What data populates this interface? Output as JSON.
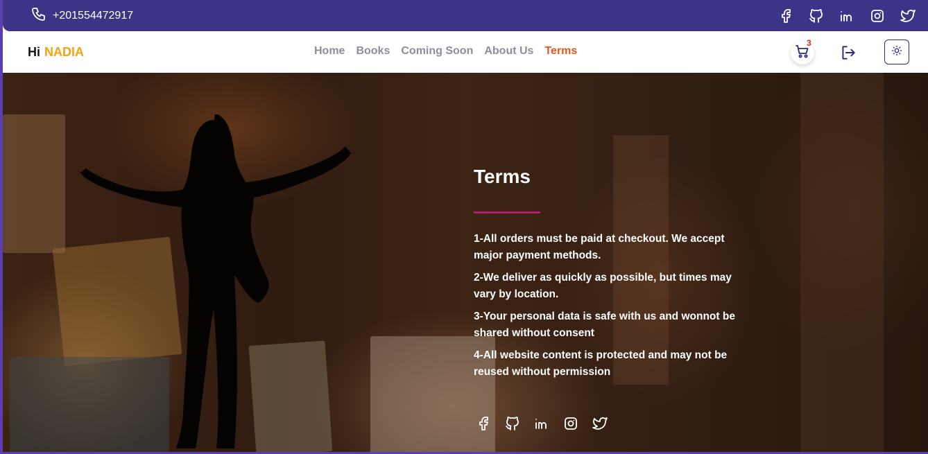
{
  "topbar": {
    "phone": "+201554472917",
    "socials": [
      "facebook-icon",
      "github-icon",
      "linkedin-icon",
      "instagram-icon",
      "twitter-icon"
    ]
  },
  "navbar": {
    "greeting": "Hi",
    "user_name": "NADIA",
    "links": [
      {
        "label": "Home",
        "active": false
      },
      {
        "label": "Books",
        "active": false
      },
      {
        "label": "Coming Soon",
        "active": false
      },
      {
        "label": "About Us",
        "active": false
      },
      {
        "label": "Terms",
        "active": true
      }
    ],
    "cart_count": "3",
    "icons": [
      "cart-icon",
      "logout-icon",
      "sun-icon"
    ]
  },
  "hero": {
    "title": "Terms",
    "items": [
      "1-All orders must be paid at checkout. We accept major payment methods.",
      "2-We deliver as quickly as possible, but times may vary by location.",
      "3-Your personal data is safe with us and wonnot be shared without consent",
      "4-All website content is protected and may not be reused without permission"
    ],
    "socials": [
      "facebook-icon",
      "github-icon",
      "linkedin-icon",
      "instagram-icon",
      "twitter-icon"
    ]
  },
  "colors": {
    "topbar": "#3c3486",
    "accent_name": "#f5a30c",
    "active_link": "#e4561e",
    "title_rule": "#b0206a"
  }
}
